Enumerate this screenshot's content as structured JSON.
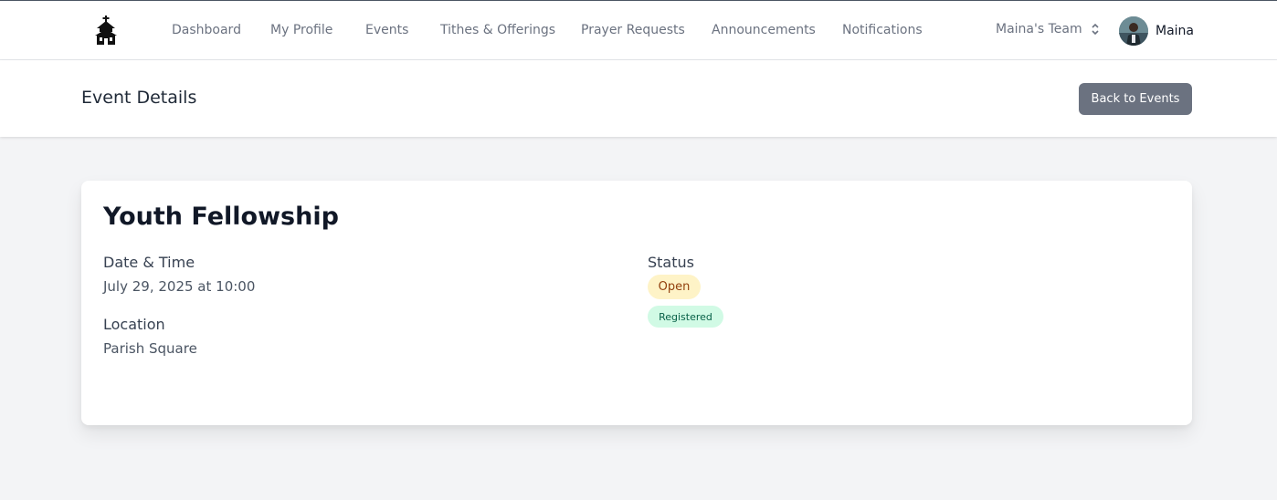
{
  "nav": {
    "links": [
      {
        "label": "Dashboard"
      },
      {
        "label": "My Profile"
      },
      {
        "label": "Events"
      },
      {
        "label": "Tithes & Offerings"
      },
      {
        "label": "Prayer Requests"
      },
      {
        "label": "Announcements"
      },
      {
        "label": "Notifications"
      }
    ],
    "team": "Maina's Team",
    "user_name": "Maina",
    "logo_icon": "church-icon",
    "team_icon": "chevron-up-down-icon"
  },
  "header": {
    "title": "Event Details",
    "back_label": "Back to Events"
  },
  "event": {
    "title": "Youth Fellowship",
    "date_label": "Date & Time",
    "date_value": "July 29, 2025 at 10:00",
    "location_label": "Location",
    "location_value": "Parish Square",
    "status_label": "Status",
    "status_badge": "Open",
    "registration_badge": "Registered"
  },
  "colors": {
    "open_badge_bg": "#fef3c7",
    "registered_badge_bg": "#d1fae5",
    "back_button_bg": "#6b7280"
  }
}
